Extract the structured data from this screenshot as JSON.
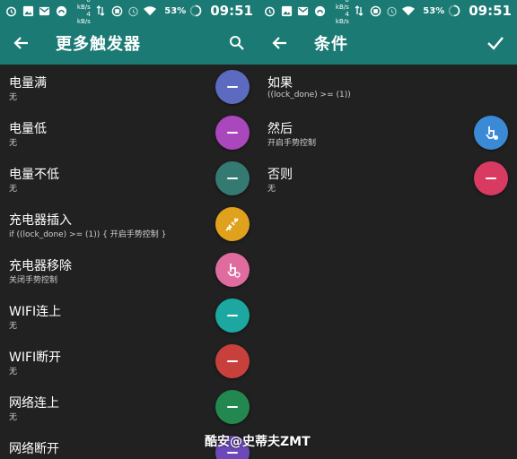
{
  "status": {
    "net_up": "0 kB/s",
    "net_down": "4 kB/s",
    "battery": "53%",
    "time": "09:51"
  },
  "left": {
    "title": "更多触发器",
    "items": [
      {
        "name": "电量满",
        "sub": "无",
        "color": "#5c6bc0",
        "icon": "minus-icon"
      },
      {
        "name": "电量低",
        "sub": "无",
        "color": "#ab47bc",
        "icon": "minus-icon"
      },
      {
        "name": "电量不低",
        "sub": "无",
        "color": "#357a72",
        "icon": "minus-icon"
      },
      {
        "name": "充电器插入",
        "sub": "if ((lock_done) >= (1)) { 开启手势控制 }",
        "color": "#e0a21d",
        "icon": "plug-icon"
      },
      {
        "name": "充电器移除",
        "sub": "关闭手势控制",
        "color": "#e06c9f",
        "icon": "gesture-off-icon"
      },
      {
        "name": "WIFI连上",
        "sub": "无",
        "color": "#1ca7a0",
        "icon": "minus-icon"
      },
      {
        "name": "WIFI断开",
        "sub": "无",
        "color": "#c8403b",
        "icon": "minus-icon"
      },
      {
        "name": "网络连上",
        "sub": "无",
        "color": "#23884f",
        "icon": "minus-icon"
      },
      {
        "name": "网络断开",
        "sub": "",
        "color": "#6d48b8",
        "icon": "minus-icon"
      }
    ]
  },
  "right": {
    "title": "条件",
    "items": [
      {
        "name": "如果",
        "sub": "((lock_done) >= (1))"
      },
      {
        "name": "然后",
        "sub": "开启手势控制",
        "color": "#3a8ad6",
        "icon": "gesture-on-icon"
      },
      {
        "name": "否则",
        "sub": "无",
        "color": "#d93a62",
        "icon": "minus-icon"
      }
    ]
  },
  "watermark": "酷安@史蒂夫ZMT"
}
